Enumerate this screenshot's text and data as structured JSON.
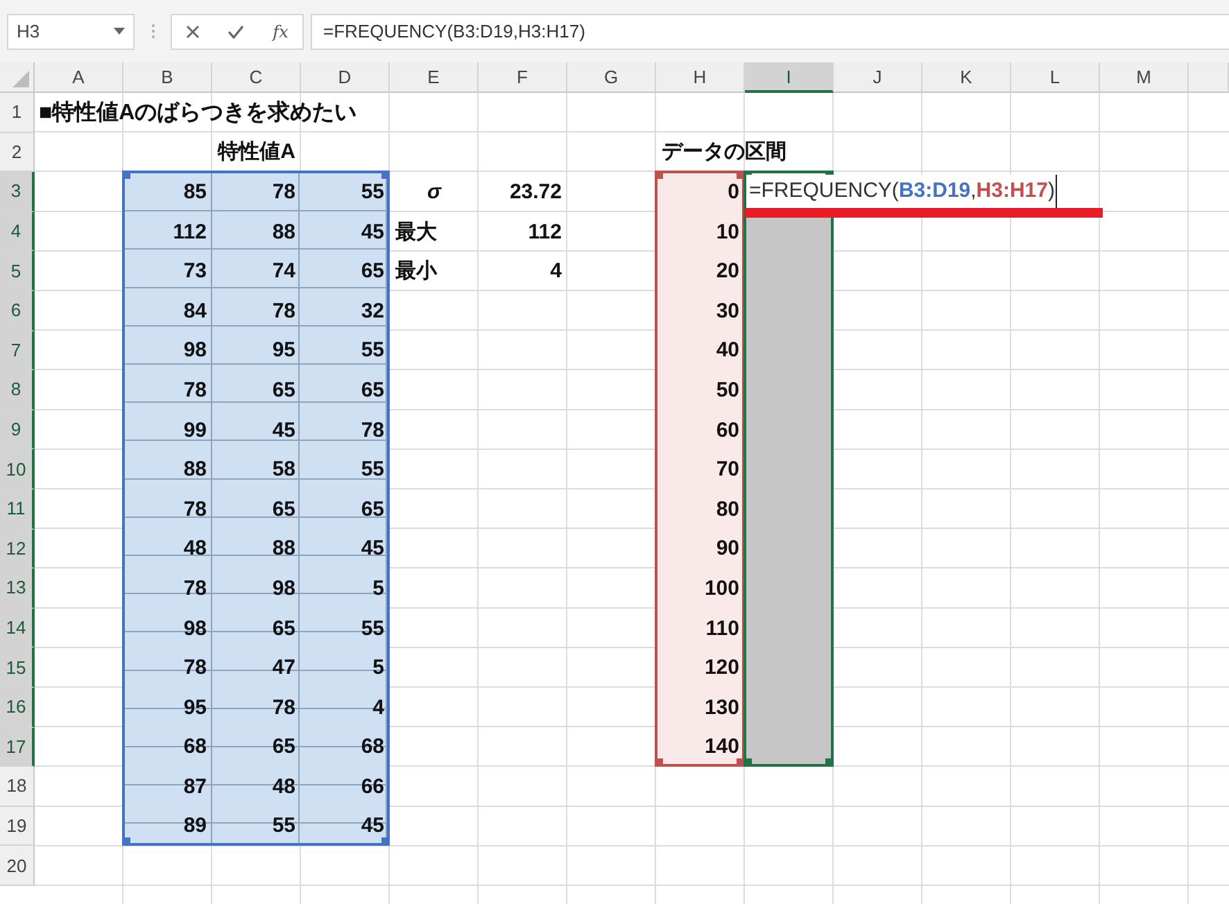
{
  "formula_bar": {
    "name_box": "H3",
    "function_label": "fx",
    "formula": "=FREQUENCY(B3:D19,H3:H17)"
  },
  "columns": [
    {
      "label": "A",
      "selected": false
    },
    {
      "label": "B",
      "selected": false
    },
    {
      "label": "C",
      "selected": false
    },
    {
      "label": "D",
      "selected": false
    },
    {
      "label": "E",
      "selected": false
    },
    {
      "label": "F",
      "selected": false
    },
    {
      "label": "G",
      "selected": false
    },
    {
      "label": "H",
      "selected": false
    },
    {
      "label": "I",
      "selected": true
    },
    {
      "label": "J",
      "selected": false
    },
    {
      "label": "K",
      "selected": false
    },
    {
      "label": "L",
      "selected": false
    },
    {
      "label": "M",
      "selected": false
    }
  ],
  "rows": [
    {
      "number": "1",
      "selected": false
    },
    {
      "number": "2",
      "selected": false
    },
    {
      "number": "3",
      "selected": true
    },
    {
      "number": "4",
      "selected": true
    },
    {
      "number": "5",
      "selected": true
    },
    {
      "number": "6",
      "selected": true
    },
    {
      "number": "7",
      "selected": true
    },
    {
      "number": "8",
      "selected": true
    },
    {
      "number": "9",
      "selected": true
    },
    {
      "number": "10",
      "selected": true
    },
    {
      "number": "11",
      "selected": true
    },
    {
      "number": "12",
      "selected": true
    },
    {
      "number": "13",
      "selected": true
    },
    {
      "number": "14",
      "selected": true
    },
    {
      "number": "15",
      "selected": true
    },
    {
      "number": "16",
      "selected": true
    },
    {
      "number": "17",
      "selected": true
    },
    {
      "number": "18",
      "selected": false
    },
    {
      "number": "19",
      "selected": false
    },
    {
      "number": "20",
      "selected": false
    }
  ],
  "title": "■特性値Aのばらつきを求めたい",
  "sample": {
    "heading": "特性値A",
    "color": "#4472c4",
    "values": [
      [
        "85",
        "78",
        "55"
      ],
      [
        "112",
        "88",
        "45"
      ],
      [
        "73",
        "74",
        "65"
      ],
      [
        "84",
        "78",
        "32"
      ],
      [
        "98",
        "95",
        "55"
      ],
      [
        "78",
        "65",
        "65"
      ],
      [
        "99",
        "45",
        "78"
      ],
      [
        "88",
        "58",
        "55"
      ],
      [
        "78",
        "65",
        "65"
      ],
      [
        "48",
        "88",
        "45"
      ],
      [
        "78",
        "98",
        "5"
      ],
      [
        "98",
        "65",
        "55"
      ],
      [
        "78",
        "47",
        "5"
      ],
      [
        "95",
        "78",
        "4"
      ],
      [
        "68",
        "65",
        "68"
      ],
      [
        "87",
        "48",
        "66"
      ],
      [
        "89",
        "55",
        "45"
      ]
    ]
  },
  "stats": [
    {
      "label": "σ",
      "kind": "symbol",
      "value": "23.72"
    },
    {
      "label": "最大",
      "kind": "text",
      "value": "112"
    },
    {
      "label": "最小",
      "kind": "text",
      "value": "4"
    }
  ],
  "bins": {
    "heading": "データの区間",
    "color": "#c0504d",
    "values": [
      "0",
      "10",
      "20",
      "30",
      "40",
      "50",
      "60",
      "70",
      "80",
      "90",
      "100",
      "110",
      "120",
      "130",
      "140"
    ]
  },
  "output": {
    "color": "#217346",
    "underline": true,
    "parts": [
      {
        "text": "=FREQUENCY("
      },
      {
        "text": "B3:D19",
        "color": "#4472c4"
      },
      {
        "text": ","
      },
      {
        "text": "H3:H17",
        "color": "#c0504d"
      },
      {
        "text": ")"
      }
    ]
  }
}
